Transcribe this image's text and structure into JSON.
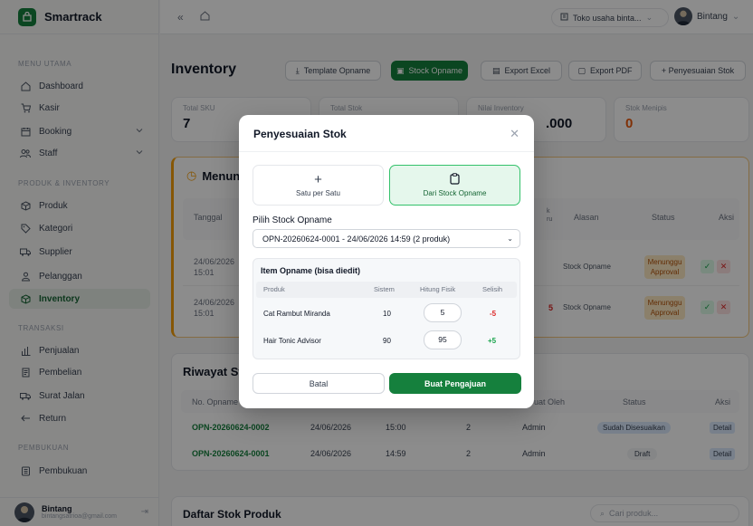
{
  "app": {
    "name": "Smartrack"
  },
  "sidebar": {
    "sections": {
      "main": "MENU UTAMA",
      "product": "PRODUK & INVENTORY",
      "trans": "TRANSAKSI",
      "books": "PEMBUKUAN"
    },
    "items": [
      {
        "label": "Dashboard",
        "icon": "home-icon"
      },
      {
        "label": "Kasir",
        "icon": "cart-icon"
      },
      {
        "label": "Booking",
        "icon": "calendar-icon"
      },
      {
        "label": "Staff",
        "icon": "users-icon"
      },
      {
        "label": "Produk",
        "icon": "box-icon"
      },
      {
        "label": "Kategori",
        "icon": "tag-icon"
      },
      {
        "label": "Supplier",
        "icon": "truck-icon"
      },
      {
        "label": "Pelanggan",
        "icon": "customers-icon"
      },
      {
        "label": "Inventory",
        "icon": "inventory-icon"
      },
      {
        "label": "Penjualan",
        "icon": "bar-chart-icon"
      },
      {
        "label": "Pembelian",
        "icon": "receipt-icon"
      },
      {
        "label": "Surat Jalan",
        "icon": "delivery-icon"
      },
      {
        "label": "Return",
        "icon": "return-icon"
      },
      {
        "label": "Pembukuan",
        "icon": "ledger-icon"
      }
    ],
    "user": {
      "name": "Bintang",
      "email": "bintangsatrioa@gmail.com"
    }
  },
  "topbar": {
    "store": "Toko usaha binta...",
    "user": "Bintang"
  },
  "main": {
    "title": "Inventory",
    "buttons": {
      "template": "Template Opname",
      "stock_opname": "Stock Opname",
      "export_excel": "Export Excel",
      "export_pdf": "Export PDF",
      "adjust": "+ Penyesuaian Stok"
    },
    "stats": [
      {
        "label": "Total SKU",
        "value": "7"
      },
      {
        "label": "Total Stok",
        "value": ""
      },
      {
        "label": "Nilai Inventory",
        "value": ".000"
      },
      {
        "label": "Stok Menipis",
        "value": "0"
      }
    ],
    "pending": {
      "title": "Menung",
      "headers": {
        "date": "Tanggal",
        "col3": "k\nru",
        "reason": "Alasan",
        "status": "Status",
        "action": "Aksi"
      },
      "rows": [
        {
          "date": "24/06/2026\n15:01",
          "marker": "",
          "reason": "Stock Opname",
          "status": "Menunggu\nApproval"
        },
        {
          "date": "24/06/2026\n15:01",
          "marker": "5",
          "reason": "Stock Opname",
          "status": "Menunggu\nApproval"
        }
      ]
    },
    "history": {
      "title": "Riwayat Sto",
      "headers": {
        "no": "No. Opname",
        "by": "uat Oleh",
        "status": "Status",
        "action": "Aksi"
      },
      "rows": [
        {
          "no": "OPN-20260624-0002",
          "date": "24/06/2026",
          "time": "15:00",
          "count": "2",
          "by": "Admin",
          "status": "Sudah Disesuaikan",
          "action": "Detail"
        },
        {
          "no": "OPN-20260624-0001",
          "date": "24/06/2026",
          "time": "14:59",
          "count": "2",
          "by": "Admin",
          "status": "Draft",
          "action": "Detail"
        }
      ]
    },
    "list": {
      "title": "Daftar Stok Produk",
      "search_placeholder": "Cari produk..."
    }
  },
  "modal": {
    "title": "Penyesuaian Stok",
    "choices": {
      "single": "Satu per Satu",
      "opname": "Dari Stock Opname"
    },
    "select_label": "Pilih Stock Opname",
    "selected": "OPN-20260624-0001 - 24/06/2026 14:59 (2 produk)",
    "items_title": "Item Opname (bisa diedit)",
    "headers": {
      "product": "Produk",
      "system": "Sistem",
      "count": "Hitung Fisik",
      "diff": "Selisih"
    },
    "items": [
      {
        "product": "Cat Rambut Miranda",
        "system": "10",
        "count": "5",
        "diff": "-5"
      },
      {
        "product": "Hair Tonic Advisor",
        "system": "90",
        "count": "95",
        "diff": "+5"
      }
    ],
    "cancel": "Batal",
    "submit": "Buat Pengajuan"
  }
}
